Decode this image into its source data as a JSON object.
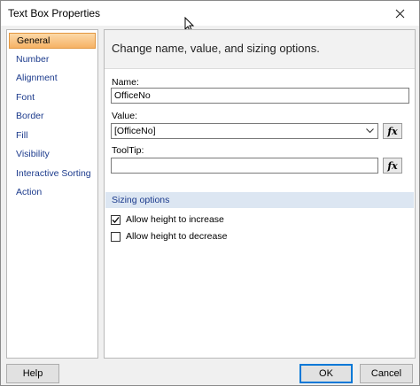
{
  "window": {
    "title": "Text Box Properties"
  },
  "sidebar": {
    "items": [
      {
        "label": "General",
        "selected": true
      },
      {
        "label": "Number",
        "selected": false
      },
      {
        "label": "Alignment",
        "selected": false
      },
      {
        "label": "Font",
        "selected": false
      },
      {
        "label": "Border",
        "selected": false
      },
      {
        "label": "Fill",
        "selected": false
      },
      {
        "label": "Visibility",
        "selected": false
      },
      {
        "label": "Interactive Sorting",
        "selected": false
      },
      {
        "label": "Action",
        "selected": false
      }
    ]
  },
  "main": {
    "header": "Change name, value, and sizing options.",
    "name_label": "Name:",
    "name_value": "OfficeNo",
    "value_label": "Value:",
    "value_value": "[OfficeNo]",
    "tooltip_label": "ToolTip:",
    "tooltip_value": "",
    "fx_label": "fx",
    "sizing": {
      "title": "Sizing options",
      "grow_label": "Allow height to increase",
      "grow_checked": true,
      "shrink_label": "Allow height to decrease",
      "shrink_checked": false
    }
  },
  "footer": {
    "help_label": "Help",
    "ok_label": "OK",
    "cancel_label": "Cancel"
  },
  "colors": {
    "selected_item_bg": "#f6b266",
    "section_band": "#dce6f2",
    "link_text": "#1b3a8c",
    "primary_border": "#0078d7"
  },
  "icons": {
    "close": "close-icon",
    "combo": "chevron-down-icon",
    "check": "checkmark-icon",
    "cursor": "mouse-cursor-icon"
  }
}
